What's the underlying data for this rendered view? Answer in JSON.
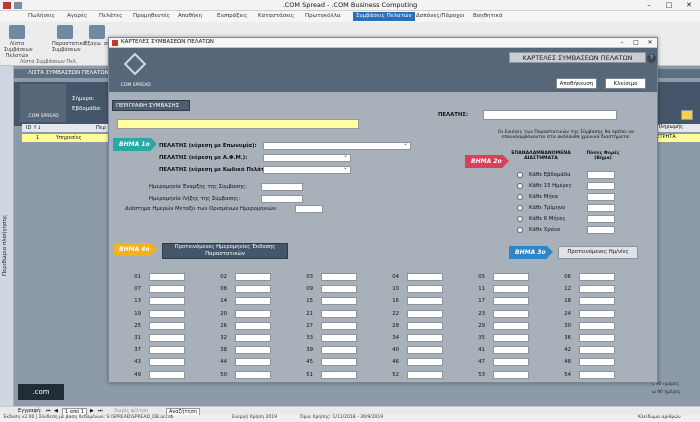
{
  "window": {
    "title": ".COM Spread - .COM Business Computing",
    "controls": [
      "–",
      "□",
      "✕"
    ]
  },
  "menu": [
    "Πωλήσεις",
    "Αγορές",
    "Πελάτες",
    "Προμηθευτές",
    "Αποθήκη",
    "Εισπράξεις",
    "Καταστάσεις",
    "Πρωτοκόλλα",
    "Συμβάσεις Πελατών",
    "Δαπάνες/Πάροχοι",
    "Βοηθητικά"
  ],
  "ribbon": {
    "buttons": [
      "Λίστα Συμβάσεων Πελατών",
      "Παραστατικά Συμβάσεων",
      "Εξαγω. σε"
    ],
    "group": "Λίστα Συμβάσεων Πελ."
  },
  "background": {
    "header": "ΛΙΣΤΑ ΣΥΜΒΑΣΕΩΝ ΠΕΛΑΤΩΝ",
    "logo_text": ".COM SPREAD",
    "labels": [
      "Σήμερα:",
      "Εβδομάδα:"
    ],
    "grid_header": "ID ↑↓",
    "grid_header_2": "Περ",
    "row_id": "1",
    "row_value": "Υπηρεσίες",
    "right_header": "ς Πληρωμής",
    "right_value": "ΜΕΤΡΗΤΑ",
    "right_labels": [
      "ε 90 ημέρες",
      "ω 90 ημέρες"
    ],
    "side_label": "Περιθώριο πλοήγησης",
    "bottom_logo": ".com"
  },
  "navbar": {
    "record_label": "Εγγραφή:",
    "record_value": "1 από 1",
    "no_filter": "Χωρίς φίλτρο",
    "search": "Αναζήτηση"
  },
  "status": {
    "left": "Έκδοση v2.00 | Σύνδεση με βάση δεδομένων: S:\\SPREAD\\SPREAD_DB.accdb",
    "year": "Ενεργή Χρήση 2019",
    "range": "Όρια Χρήσης: 1/11/2018 - 30/9/2019",
    "right": "Κλείδωμα αριθμών"
  },
  "dialog": {
    "title": "ΚΑΡΤΕΛΕΣ ΣΥΜΒΑΣΕΩΝ ΠΕΛΑΤΩΝ",
    "big_title": "ΚΑΡΤΕΛΕΣ ΣΥΜΒΑΣΕΩΝ ΠΕΛΑΤΩΝ",
    "logo_text": ".COM SPREAD",
    "save": "Αποθήκευση",
    "close": "Κλείσιμο",
    "perigrafi": "ΠΕΡΙΓΡΑΦΗ ΣΥΜΒΑΣΗΣ",
    "pelatis_label": "ΠΕΛΑΤΗΣ:",
    "step1": "ΒΗΜΑ 1ο",
    "step2": "ΒΗΜΑ 2ο",
    "step3": "ΒΗΜΑ 3ο",
    "step4": "ΒΗΜΑ 4ο",
    "pelatis_name": "ΠΕΛΑΤΗΣ (εύρεση με Επωνυμία):",
    "pelatis_afm": "ΠΕΛΑΤΗΣ (εύρεση με Α.Φ.Μ.):",
    "pelatis_code": "ΠΕΛΑΤΗΣ (εύρεση με Κωδικό Πελάτη):",
    "start_date": "Ημερομηνία Έναρξης της Σύμβασης:",
    "end_date": "Ημερομηνία Λήξης της Σύμβασης:",
    "interval": "Διάστημα Ημερών Μεταξύ των Ορισμένων Ημερομηνιών:",
    "info": "Οι Εικόνες των Παραστατικών της Σύμβασης θα πρέπει να επαναλαμβάνονται στα ακόλουθα χρονικά διαστήματα:",
    "recurring_title": "ΕΠΑΝΑΛΑΜΒΑΝΟΜΕΝΑ ΔΙΑΣΤΗΜΑΤΑ",
    "multiplier_title": "Πόσες Φορές (Βήμα)",
    "intervals": [
      "Κάθε Εβδομάδα",
      "Κάθε 15 Ημέρες",
      "Κάθε Μήνα",
      "Κάθε Τρίμηνο",
      "Κάθε 6 Μήνες",
      "Κάθε Χρόνο"
    ],
    "suggested_dates_btn": "Προτεινόμενες Ημερομηνίες Έκδοσης Παραστατικών",
    "suggested_short_btn": "Προτεινόμενες Ημ/νίες",
    "numbers": [
      [
        "01",
        "02",
        "03",
        "04",
        "05",
        "06"
      ],
      [
        "07",
        "08",
        "09",
        "10",
        "11",
        "12"
      ],
      [
        "13",
        "14",
        "15",
        "16",
        "17",
        "18"
      ],
      [
        "19",
        "20",
        "21",
        "22",
        "23",
        "24"
      ],
      [
        "25",
        "26",
        "27",
        "28",
        "29",
        "30"
      ],
      [
        "31",
        "32",
        "33",
        "34",
        "35",
        "36"
      ],
      [
        "37",
        "38",
        "39",
        "40",
        "41",
        "42"
      ],
      [
        "43",
        "44",
        "45",
        "46",
        "47",
        "48"
      ],
      [
        "49",
        "50",
        "51",
        "52",
        "53",
        "54"
      ]
    ]
  }
}
